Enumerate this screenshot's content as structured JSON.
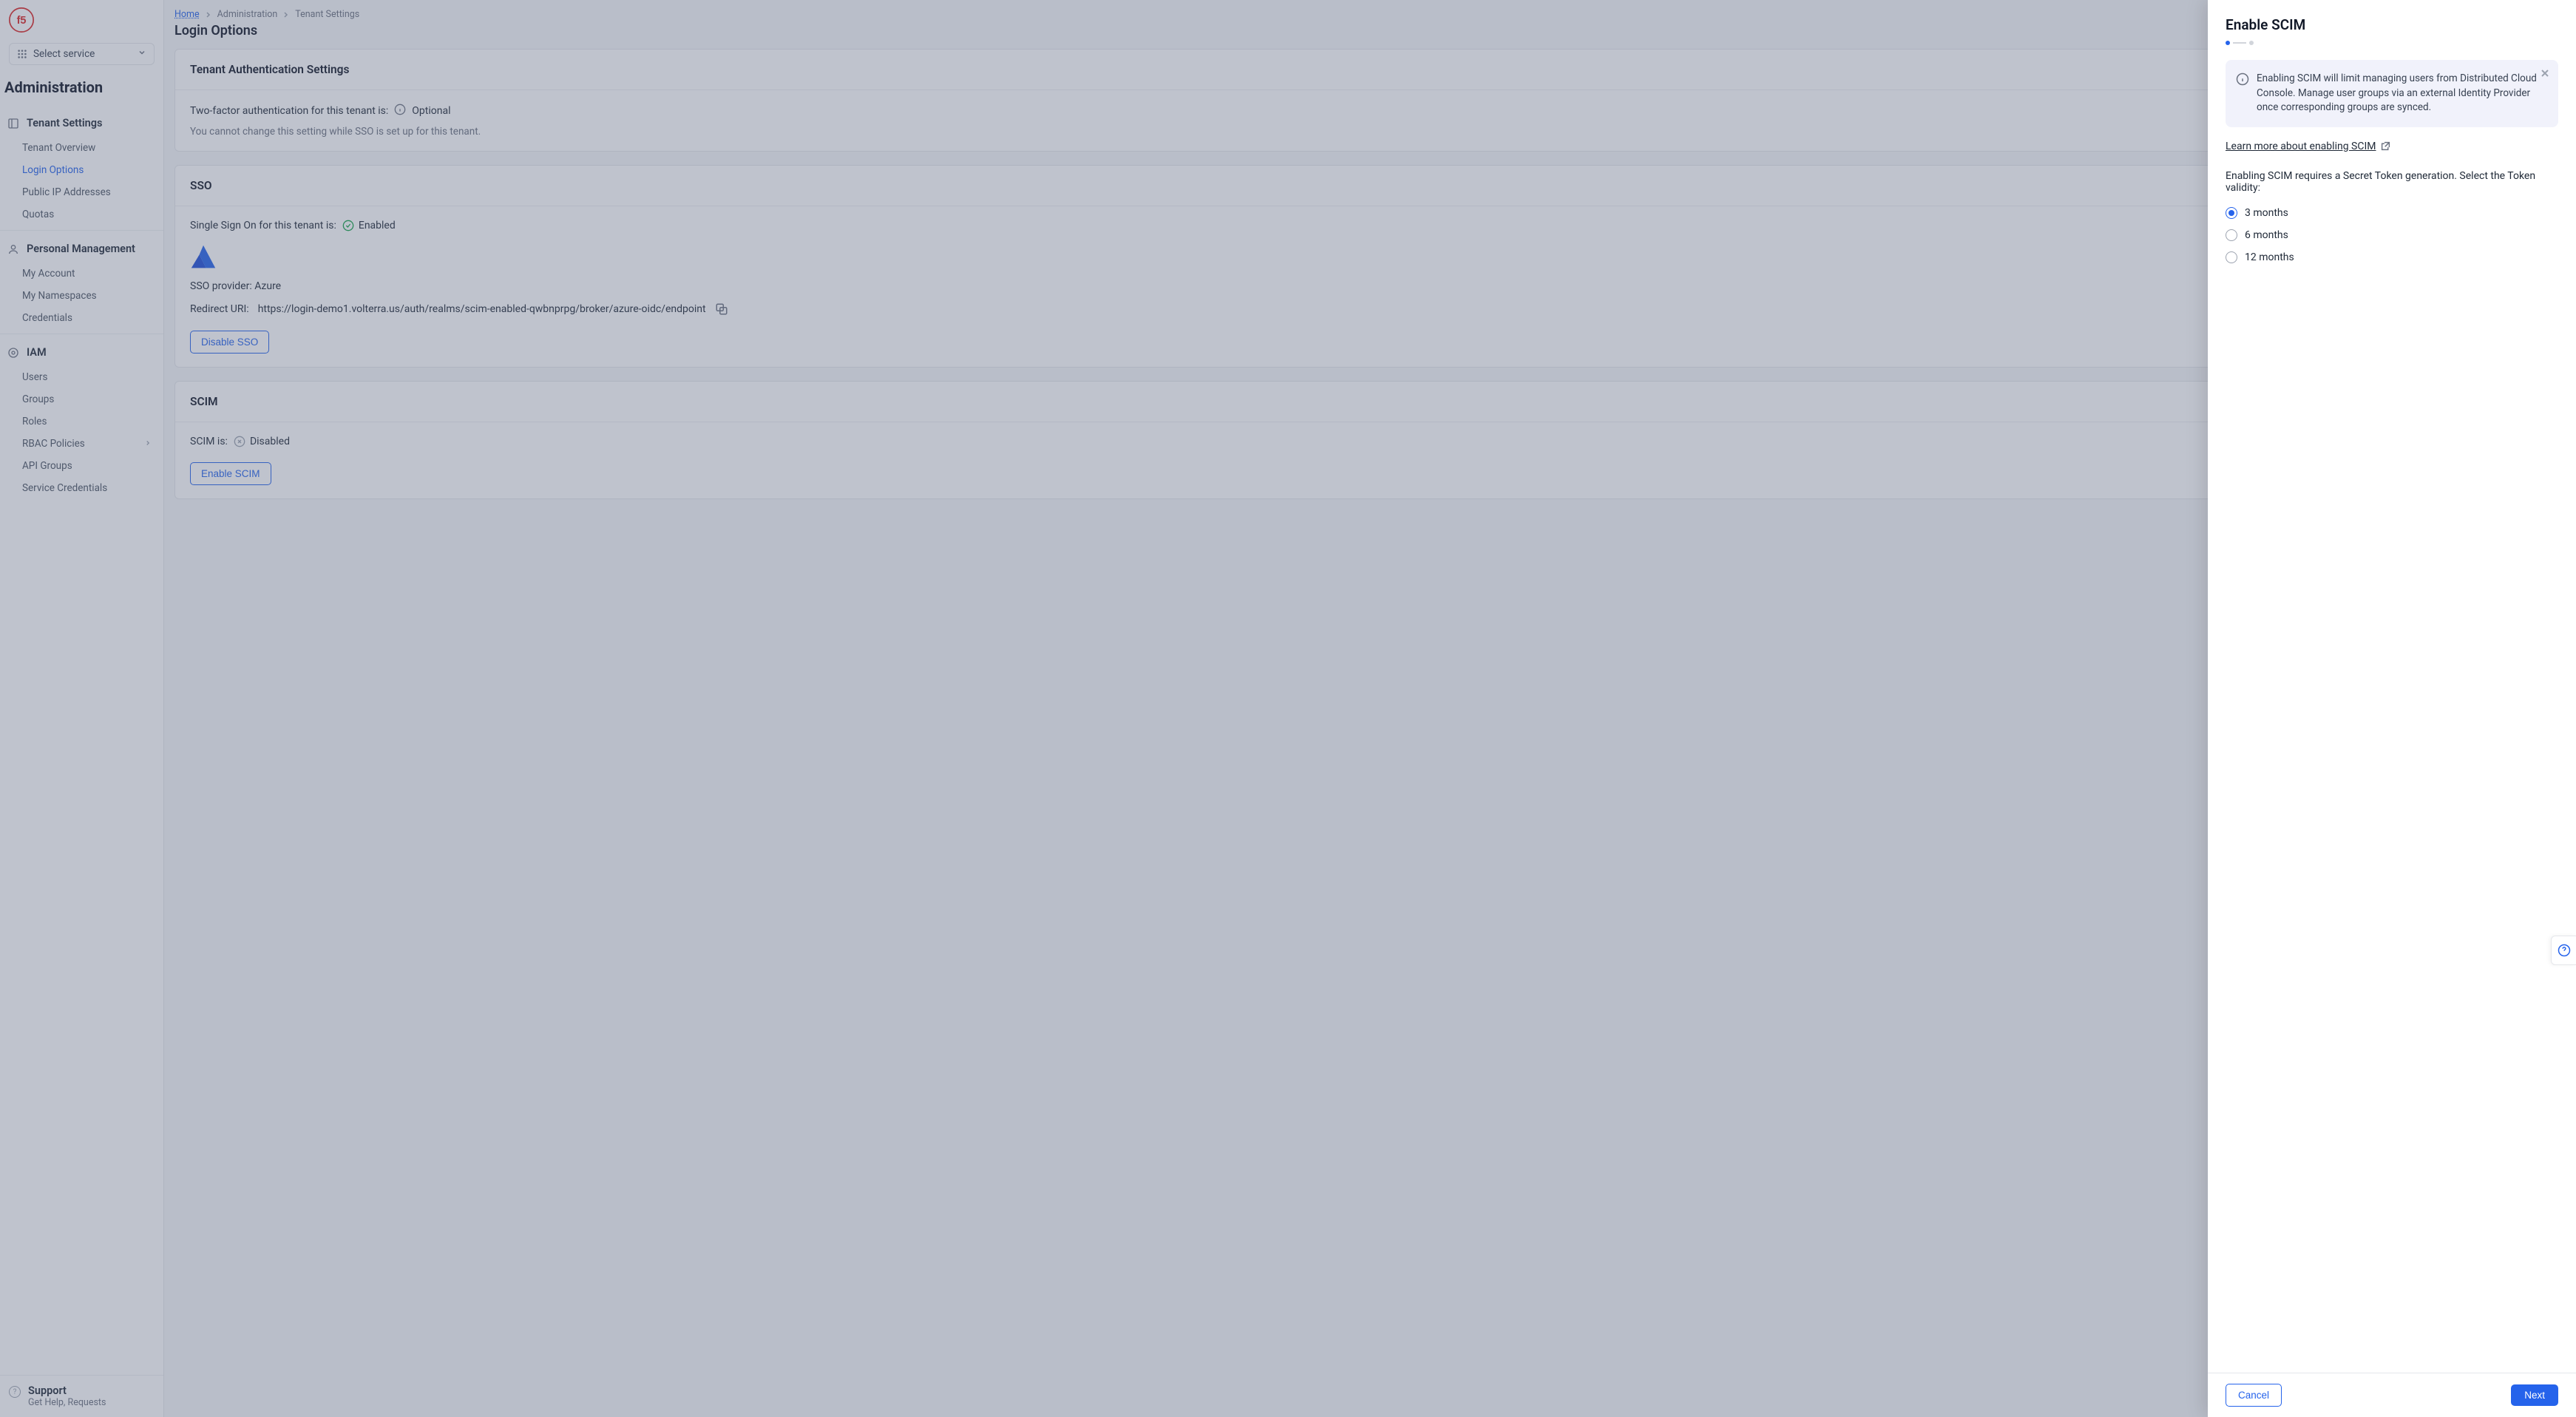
{
  "service_select": {
    "label": "Select service"
  },
  "sidebar": {
    "title": "Administration",
    "sections": [
      {
        "heading": "Tenant Settings",
        "items": [
          {
            "label": "Tenant Overview"
          },
          {
            "label": "Login Options"
          },
          {
            "label": "Public IP Addresses"
          },
          {
            "label": "Quotas"
          }
        ]
      },
      {
        "heading": "Personal Management",
        "items": [
          {
            "label": "My Account"
          },
          {
            "label": "My Namespaces"
          },
          {
            "label": "Credentials"
          }
        ]
      },
      {
        "heading": "IAM",
        "items": [
          {
            "label": "Users"
          },
          {
            "label": "Groups"
          },
          {
            "label": "Roles"
          },
          {
            "label": "RBAC Policies"
          },
          {
            "label": "API Groups"
          },
          {
            "label": "Service Credentials"
          }
        ]
      }
    ],
    "support": {
      "title": "Support",
      "sub": "Get Help, Requests"
    }
  },
  "breadcrumb": [
    {
      "label": "Home"
    },
    {
      "label": "Administration"
    },
    {
      "label": "Tenant Settings"
    }
  ],
  "page_title": "Login Options",
  "tenant_auth": {
    "heading": "Tenant Authentication Settings",
    "row_label": "Two-factor authentication for this tenant is:",
    "status": "Optional",
    "note": "You cannot change this setting while SSO is set up for this tenant."
  },
  "sso": {
    "heading": "SSO",
    "row_label": "Single Sign On for this tenant is:",
    "status": "Enabled",
    "provider_line": "SSO provider: Azure",
    "uri_label": "Redirect URI:",
    "uri_value": "https://login-demo1.volterra.us/auth/realms/scim-enabled-qwbnprpg/broker/azure-oidc/endpoint",
    "disable_btn": "Disable SSO"
  },
  "scim": {
    "heading": "SCIM",
    "row_label": "SCIM is:",
    "status": "Disabled",
    "enable_btn": "Enable SCIM"
  },
  "drawer": {
    "title": "Enable SCIM",
    "info": "Enabling SCIM will limit managing users from Distributed Cloud Console. Manage user groups via an external Identity Provider once corresponding groups are synced.",
    "learn_link": "Learn more about enabling SCIM",
    "prompt": "Enabling SCIM requires a Secret Token generation. Select the Token validity:",
    "options": [
      {
        "label": "3 months"
      },
      {
        "label": "6 months"
      },
      {
        "label": "12 months"
      }
    ],
    "cancel": "Cancel",
    "next": "Next"
  }
}
